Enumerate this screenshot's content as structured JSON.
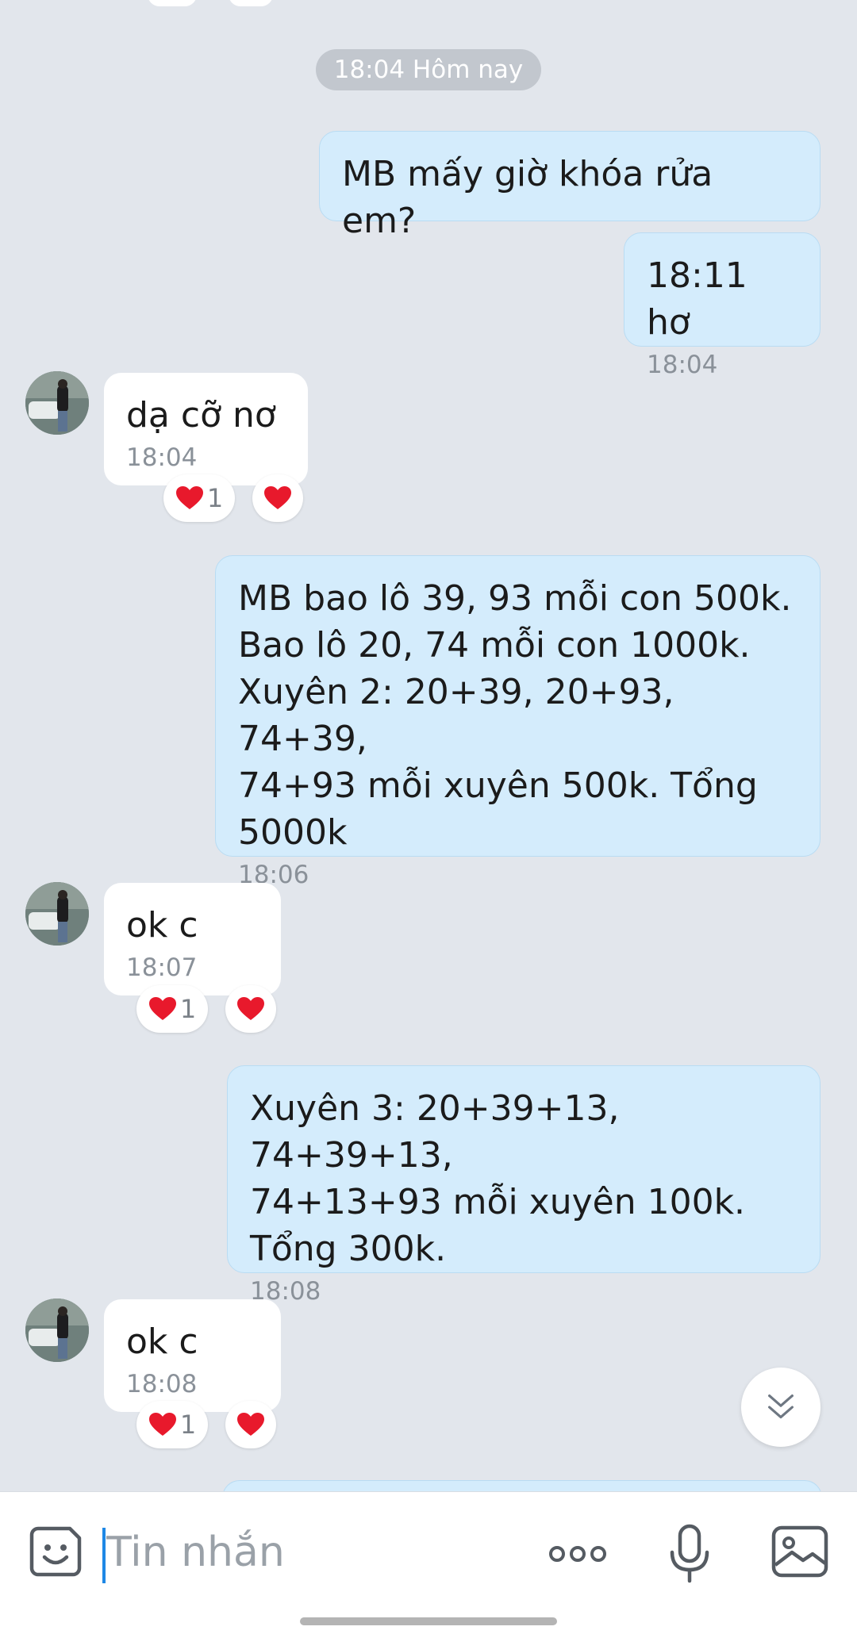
{
  "date_separator": "18:04 Hôm nay",
  "messages": [
    {
      "dir": "out",
      "text": "MB mấy giờ khóa rửa em?",
      "time": ""
    },
    {
      "dir": "out",
      "text": "18:11 hơ",
      "time": "18:04"
    },
    {
      "dir": "in",
      "text": "dạ cỡ nơ",
      "time": "18:04",
      "reaction_count": "1"
    },
    {
      "dir": "out",
      "text": "MB bao lô 39, 93 mỗi con 500k.\nBao lô 20, 74 mỗi con 1000k.\nXuyên 2: 20+39, 20+93, 74+39,\n74+93 mỗi xuyên 500k. Tổng\n5000k",
      "time": "18:06"
    },
    {
      "dir": "in",
      "text": "ok c",
      "time": "18:07",
      "reaction_count": "1"
    },
    {
      "dir": "out",
      "text": "Xuyên 3: 20+39+13, 74+39+13,\n74+13+93 mỗi xuyên 100k.\nTổng 300k.",
      "time": "18:08"
    },
    {
      "dir": "in",
      "text": "ok c",
      "time": "18:08",
      "reaction_count": "1"
    }
  ],
  "composer": {
    "placeholder": "Tin nhắn",
    "emoji_icon": "sticker-smile-icon",
    "more_icon": "more-dots-icon",
    "mic_icon": "microphone-icon",
    "image_icon": "image-icon"
  },
  "colors": {
    "background": "#e2e6ec",
    "outgoing_bubble": "#d4ecfc",
    "incoming_bubble": "#ffffff",
    "heart": "#e8192c",
    "caret": "#1e88e5"
  }
}
